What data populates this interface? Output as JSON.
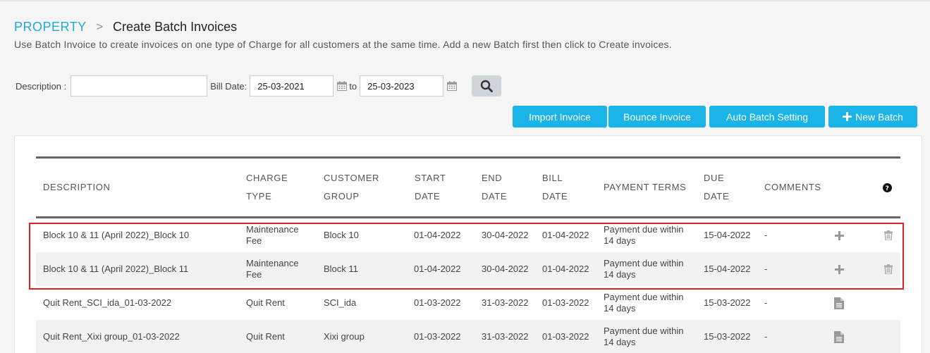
{
  "breadcrumb": {
    "root": "PROPERTY",
    "separator": ">",
    "current": "Create Batch Invoices"
  },
  "subtitle": "Use Batch Invoice to create invoices on one type of Charge for all customers at the same time. Add a new Batch first then click to Create invoices.",
  "filters": {
    "description_label": "Description :",
    "description_value": "",
    "bill_date_label": "Bill Date:",
    "date_from": "25-03-2021",
    "to_label": "to",
    "date_to": "25-03-2023"
  },
  "buttons": {
    "import": "Import Invoice",
    "bounce": "Bounce Invoice",
    "auto_batch": "Auto Batch Setting",
    "new_batch": "New Batch"
  },
  "table": {
    "headers": {
      "description": [
        "DESCRIPTION"
      ],
      "charge_type": [
        "CHARGE",
        "TYPE"
      ],
      "customer_group": [
        "CUSTOMER",
        "GROUP"
      ],
      "start_date": [
        "START",
        "DATE"
      ],
      "end_date": [
        "END",
        "DATE"
      ],
      "bill_date": [
        "BILL",
        "DATE"
      ],
      "payment_terms": [
        "PAYMENT TERMS"
      ],
      "due_date": [
        "DUE",
        "DATE"
      ],
      "comments": [
        "COMMENTS"
      ]
    },
    "rows": [
      {
        "description": "Block 10 & 11 (April 2022)_Block 10",
        "charge_type": [
          "Maintenance",
          "Fee"
        ],
        "customer_group": "Block 10",
        "start_date": "01-04-2022",
        "end_date": "30-04-2022",
        "bill_date": "01-04-2022",
        "payment_terms": [
          "Payment due within",
          "14 days"
        ],
        "due_date": "15-04-2022",
        "comments": "-"
      },
      {
        "description": "Block 10 & 11 (April 2022)_Block 11",
        "charge_type": [
          "Maintenance",
          "Fee"
        ],
        "customer_group": "Block 11",
        "start_date": "01-04-2022",
        "end_date": "30-04-2022",
        "bill_date": "01-04-2022",
        "payment_terms": [
          "Payment due within",
          "14 days"
        ],
        "due_date": "15-04-2022",
        "comments": "-"
      },
      {
        "description": "Quit Rent_SCI_ida_01-03-2022",
        "charge_type": [
          "Quit Rent"
        ],
        "customer_group": "SCI_ida",
        "start_date": "01-03-2022",
        "end_date": "31-03-2022",
        "bill_date": "01-03-2022",
        "payment_terms": [
          "Payment due within",
          "14 days"
        ],
        "due_date": "15-03-2022",
        "comments": "-"
      },
      {
        "description": "Quit Rent_Xixi group_01-03-2022",
        "charge_type": [
          "Quit Rent"
        ],
        "customer_group": "Xixi group",
        "start_date": "01-03-2022",
        "end_date": "31-03-2022",
        "bill_date": "01-03-2022",
        "payment_terms": [
          "Payment due within",
          "14 days"
        ],
        "due_date": "15-03-2022",
        "comments": "-"
      }
    ]
  },
  "colors": {
    "accent": "#1ab4e8",
    "link": "#21a9d9",
    "highlight": "#e02020"
  }
}
